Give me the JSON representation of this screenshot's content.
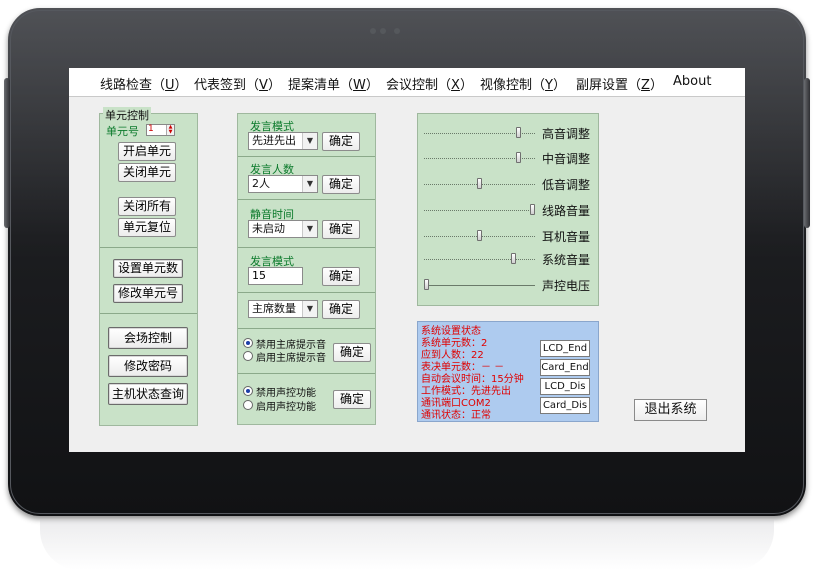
{
  "menu": [
    {
      "text": "线路检查",
      "key": "U"
    },
    {
      "text": "代表签到",
      "key": "V"
    },
    {
      "text": "提案清单",
      "key": "W"
    },
    {
      "text": "会议控制",
      "key": "X"
    },
    {
      "text": "视像控制",
      "key": "Y"
    },
    {
      "text": "副屏设置",
      "key": "Z"
    },
    {
      "text": "About",
      "key": ""
    }
  ],
  "unit_panel": {
    "legend": "单元控制",
    "unit_no_label": "单元号",
    "unit_no_value": "1",
    "open_unit": "开启单元",
    "close_unit": "关闭单元",
    "close_all": "关闭所有",
    "reset_unit": "单元复位",
    "set_unit_count": "设置单元数",
    "modify_unit_no": "修改单元号",
    "venue_control": "会场控制",
    "change_password": "修改密码",
    "host_status_query": "主机状态查询"
  },
  "speech_panel": {
    "mode_label": "发言模式",
    "mode_value": "先进先出",
    "count_label": "发言人数",
    "count_value": "2人",
    "mute_time_label": "静音时间",
    "mute_time_value": "未启动",
    "mode2_label": "发言模式",
    "mode2_value": "15",
    "chair_value": "主席数量",
    "confirm": "确定",
    "disable_chair_tone": "禁用主席提示音",
    "enable_chair_tone": "启用主席提示音",
    "disable_voice_ctrl": "禁用声控功能",
    "enable_voice_ctrl": "启用声控功能"
  },
  "audio_panel": {
    "sliders": [
      {
        "label": "高音调整",
        "value": 0.87
      },
      {
        "label": "中音调整",
        "value": 0.87
      },
      {
        "label": "低音调整",
        "value": 0.5
      },
      {
        "label": "线路音量",
        "value": 1.0
      },
      {
        "label": "耳机音量",
        "value": 0.5
      },
      {
        "label": "系统音量",
        "value": 0.82
      },
      {
        "label": "声控电压",
        "value": 0.0
      }
    ]
  },
  "status_panel": {
    "lines": [
      "系统设置状态",
      "系统单元数：2",
      "应到人数：22",
      "表决单元数：－ －",
      "自动会议时间：15分钟",
      "工作模式：先进先出",
      "通讯端口COM2",
      "通讯状态：正常"
    ],
    "buttons": [
      "LCD_End",
      "Card_End",
      "LCD_Dis",
      "Card_Dis"
    ]
  },
  "exit_label": "退出系统",
  "colors": {
    "panel_green": "#c9e2c8",
    "label_green": "#0b7a2b",
    "status_blue": "#aecbef",
    "status_red": "#e00000"
  }
}
